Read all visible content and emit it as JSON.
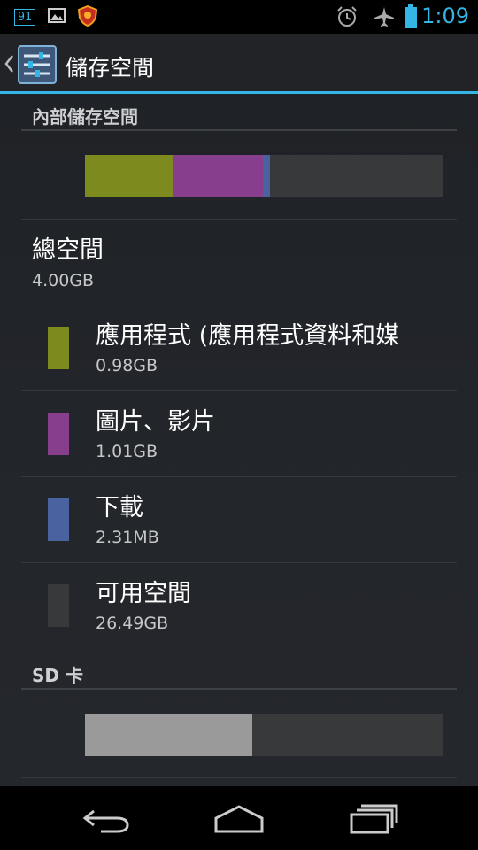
{
  "status_bar": {
    "notification_badge": "91",
    "time": "1:09",
    "icons": [
      "notification-badge-icon",
      "image-icon",
      "shield-icon",
      "alarm-icon",
      "airplane-mode-icon",
      "battery-icon"
    ]
  },
  "action_bar": {
    "title": "儲存空間",
    "icon": "settings-sliders-icon"
  },
  "internal": {
    "header": "內部儲存空間",
    "total_label": "總空間",
    "total_value": "4.00GB",
    "bar": {
      "apps": 0.245,
      "pictures": 0.252,
      "downloads": 0.02,
      "free": 0.483
    },
    "items": [
      {
        "label": "應用程式 (應用程式資料和媒",
        "value": "0.98GB",
        "color": "#7c8a1e"
      },
      {
        "label": "圖片、影片",
        "value": "1.01GB",
        "color": "#873e8d"
      },
      {
        "label": "下載",
        "value": "2.31MB",
        "color": "#4b62a0"
      },
      {
        "label": "可用空間",
        "value": "26.49GB",
        "color": "#38393b"
      }
    ]
  },
  "sd": {
    "header": "SD 卡",
    "bar": {
      "used": 0.467,
      "free": 0.533
    }
  },
  "nav": {
    "icons": [
      "back-icon",
      "home-icon",
      "recent-apps-icon"
    ]
  },
  "colors": {
    "accent": "#33b5e5",
    "apps": "#7c8a1e",
    "pictures": "#873e8d",
    "downloads": "#4b62a0",
    "free": "#38393b",
    "sd_used": "#9a9a9a"
  }
}
